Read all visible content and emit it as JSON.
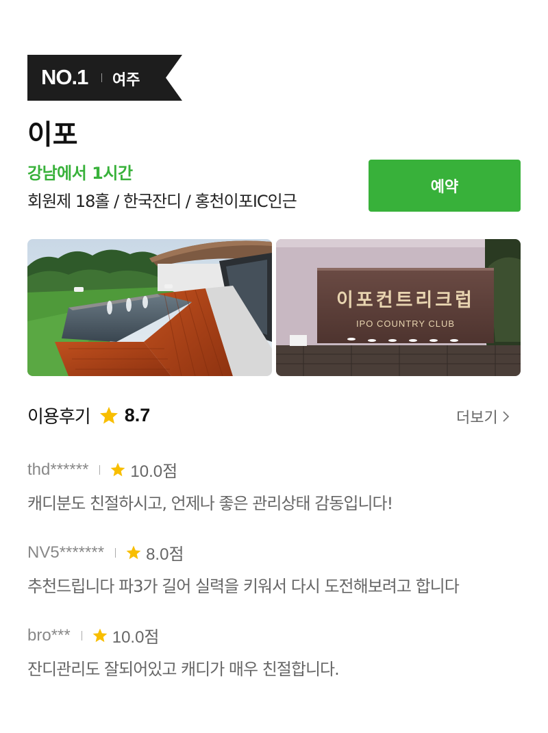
{
  "badge": {
    "rank": "NO.1",
    "region": "여주"
  },
  "club": {
    "name": "이포",
    "tagline": "강남에서 1시간",
    "features": "회원제 18홀 / 한국잔디 / 홍천이포IC인근",
    "reserve_label": "예약"
  },
  "photos": {
    "sign_korean": "이포컨트리크럽",
    "sign_english": "IPO COUNTRY CLUB"
  },
  "reviews_section": {
    "title": "이용후기",
    "score": "8.7",
    "more_label": "더보기",
    "star_color": "#f8be00",
    "accent_color": "#38b13a"
  },
  "reviews": [
    {
      "user": "thd******",
      "rating": "10.0점",
      "text": "캐디분도 친절하시고, 언제나 좋은 관리상태 감동입니다!"
    },
    {
      "user": "NV5*******",
      "rating": "8.0점",
      "text": "추천드립니다 파3가 길어 실력을 키워서 다시 도전해보려고 합니다"
    },
    {
      "user": "bro***",
      "rating": "10.0점",
      "text": "잔디관리도 잘되어있고 캐디가 매우 친절합니다."
    }
  ]
}
